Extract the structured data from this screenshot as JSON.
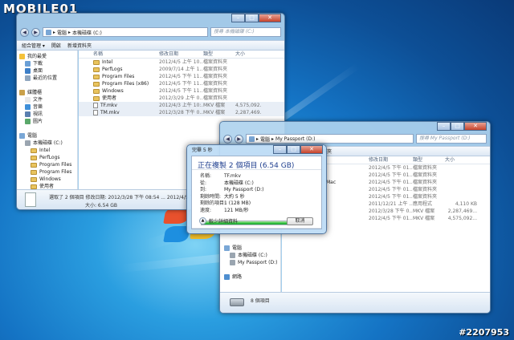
{
  "watermark": {
    "brand": "MOBILE01",
    "id": "#2207953"
  },
  "win1": {
    "address": [
      "電腦",
      "本機磁碟 (C:)"
    ],
    "search_placeholder": "搜尋 本機磁碟 (C:)",
    "toolbar": {
      "organize": "組合管理 ▾",
      "share": "開啟",
      "new_folder": "新增資料夾"
    },
    "nav": [
      {
        "label": "我的最愛",
        "icon": "star-icon",
        "level": 0
      },
      {
        "label": "下載",
        "icon": "download-icon",
        "level": 1
      },
      {
        "label": "桌面",
        "icon": "desktop-icon",
        "level": 1
      },
      {
        "label": "最近的位置",
        "icon": "recent-icon",
        "level": 1
      },
      {
        "label": "",
        "icon": "",
        "level": 0
      },
      {
        "label": "媒體櫃",
        "icon": "library-icon",
        "level": 0
      },
      {
        "label": "文件",
        "icon": "document-icon",
        "level": 1
      },
      {
        "label": "音樂",
        "icon": "music-icon",
        "level": 1
      },
      {
        "label": "視訊",
        "icon": "video-icon",
        "level": 1
      },
      {
        "label": "圖片",
        "icon": "picture-icon",
        "level": 1
      },
      {
        "label": "",
        "icon": "",
        "level": 0
      },
      {
        "label": "電腦",
        "icon": "computer-icon",
        "level": 0
      },
      {
        "label": "本機磁碟 (C:)",
        "icon": "drive-icon",
        "level": 1
      },
      {
        "label": "Intel",
        "icon": "folder-icon",
        "level": 2
      },
      {
        "label": "PerfLogs",
        "icon": "folder-icon",
        "level": 2
      },
      {
        "label": "Program Files",
        "icon": "folder-icon",
        "level": 2
      },
      {
        "label": "Program Files",
        "icon": "folder-icon",
        "level": 2
      },
      {
        "label": "Windows",
        "icon": "folder-icon",
        "level": 2
      },
      {
        "label": "使用者",
        "icon": "folder-icon",
        "level": 2
      }
    ],
    "columns": [
      "名稱",
      "修改日期",
      "類型",
      "大小"
    ],
    "rows": [
      {
        "name": "Intel",
        "date": "2012/4/5 上午 10...",
        "type": "檔案資料夾",
        "size": "",
        "kind": "folder",
        "selected": false
      },
      {
        "name": "PerfLogs",
        "date": "2009/7/14 上午 1...",
        "type": "檔案資料夾",
        "size": "",
        "kind": "folder",
        "selected": false
      },
      {
        "name": "Program Files",
        "date": "2012/4/5 下午 11...",
        "type": "檔案資料夾",
        "size": "",
        "kind": "folder",
        "selected": false
      },
      {
        "name": "Program Files (x86)",
        "date": "2012/4/5 下午 11...",
        "type": "檔案資料夾",
        "size": "",
        "kind": "folder",
        "selected": false
      },
      {
        "name": "Windows",
        "date": "2012/4/5 下午 11...",
        "type": "檔案資料夾",
        "size": "",
        "kind": "folder",
        "selected": false
      },
      {
        "name": "使用者",
        "date": "2012/3/29 上午 0...",
        "type": "檔案資料夾",
        "size": "",
        "kind": "folder",
        "selected": false
      },
      {
        "name": "TF.mkv",
        "date": "2012/4/3 上午 10:...",
        "type": "MKV 檔案",
        "size": "4,575,092...",
        "kind": "file",
        "selected": true
      },
      {
        "name": "TM.mkv",
        "date": "2012/3/28 下午 0...",
        "type": "MKV 檔案",
        "size": "2,287,469...",
        "kind": "file",
        "selected": true
      }
    ],
    "details": {
      "line1": "選取了 2 個項目  修改日期: 2012/3/28 下午 08:54 ... 2012/4/5 下午 11:00",
      "line2": "大小: 6.54 GB"
    }
  },
  "win2": {
    "address": [
      "電腦",
      "My Passport (D:)"
    ],
    "search_placeholder": "搜尋 My Passport (D:)",
    "toolbar": {
      "share": "燒錄",
      "new_folder": "新增資料夾"
    },
    "nav": [
      {
        "label": "電腦",
        "icon": "computer-icon",
        "level": 0
      },
      {
        "label": "本機磁碟 (C:)",
        "icon": "drive-icon",
        "level": 1
      },
      {
        "label": "My Passport (D:)",
        "icon": "drive-icon",
        "level": 1
      },
      {
        "label": "",
        "icon": "",
        "level": 0
      },
      {
        "label": "網路",
        "icon": "network-icon",
        "level": 0
      }
    ],
    "columns": [
      "修改日期",
      "類型",
      "大小"
    ],
    "rows": [
      {
        "name": "",
        "date": "2012/4/5 下午 01...",
        "type": "檔案資料夾",
        "size": ""
      },
      {
        "name": "",
        "date": "2012/4/5 下午 01...",
        "type": "檔案資料夾",
        "size": ""
      },
      {
        "name": "Mac",
        "date": "2012/4/5 下午 01...",
        "type": "檔案資料夾",
        "size": ""
      },
      {
        "name": "",
        "date": "2012/4/5 下午 01...",
        "type": "檔案資料夾",
        "size": ""
      },
      {
        "name": "",
        "date": "2012/4/5 下午 01...",
        "type": "檔案資料夾",
        "size": ""
      },
      {
        "name": "",
        "date": "2011/12/21 上午 ...",
        "type": "應用程式",
        "size": "4,110 KB"
      },
      {
        "name": "",
        "date": "2012/3/28 下午 0...",
        "type": "MKV 檔案",
        "size": "2,287,469..."
      },
      {
        "name": "",
        "date": "2012/4/5 下午 01...",
        "type": "MKV 檔案",
        "size": "4,575,092..."
      }
    ],
    "details": {
      "count": "8 個項目"
    }
  },
  "dialog": {
    "title": "完畢 5 秒",
    "heading": "正在複製 2 個項目 (6.54 GB)",
    "fields": [
      {
        "k": "名稱:",
        "v": "TF.mkv"
      },
      {
        "k": "從:",
        "v": "本機磁碟 (C:)"
      },
      {
        "k": "到:",
        "v": "My Passport (D:)"
      },
      {
        "k": "剩餘時間:",
        "v": "大約 5 秒"
      },
      {
        "k": "剩餘的項目:",
        "v": "1 (128 MB)"
      },
      {
        "k": "速度:",
        "v": "121 MB/秒"
      }
    ],
    "progress": 0.98,
    "less_info": "較少詳細資料",
    "cancel": "取消"
  }
}
